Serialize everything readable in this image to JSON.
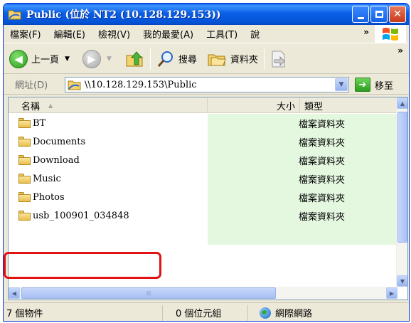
{
  "window": {
    "title": "Public (位於 NT2 (10.128.129.153))"
  },
  "menubar": {
    "items": [
      "檔案(F)",
      "編輯(E)",
      "檢視(V)",
      "我的最愛(A)",
      "工具(T)",
      "說"
    ],
    "more": "»"
  },
  "toolbar": {
    "back_label": "上一頁",
    "search_label": "搜尋",
    "folders_label": "資料夾",
    "more": "»"
  },
  "addressbar": {
    "label": "網址(D)",
    "path": "\\\\10.128.129.153\\Public",
    "go_label": "移至"
  },
  "listview": {
    "columns": {
      "name": "名稱",
      "size": "大小",
      "type": "類型"
    },
    "rows": [
      {
        "name": "BT",
        "type": "檔案資料夾"
      },
      {
        "name": "Documents",
        "type": "檔案資料夾"
      },
      {
        "name": "Download",
        "type": "檔案資料夾"
      },
      {
        "name": "Music",
        "type": "檔案資料夾"
      },
      {
        "name": "Photos",
        "type": "檔案資料夾"
      },
      {
        "name": "usb_100901_034848",
        "type": "檔案資料夾"
      }
    ]
  },
  "statusbar": {
    "object_count": "7 個物件",
    "size": "0 個位元組",
    "zone": "網際網路"
  },
  "colors": {
    "title_blue": "#0a5fe6",
    "annotation_red": "#e21212",
    "row_highlight": "#e4f8e0"
  }
}
